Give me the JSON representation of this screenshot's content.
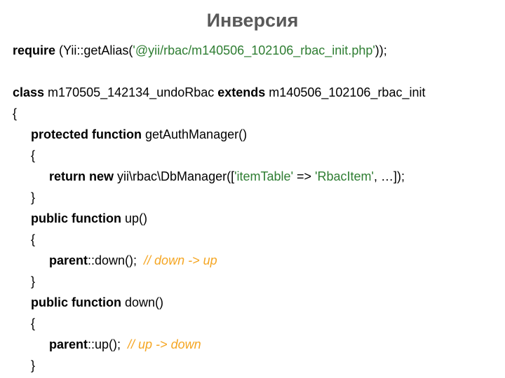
{
  "title": "Инверсия",
  "code": {
    "l1": {
      "a": "require",
      "b": " (Yii::getAlias(",
      "c": "'@yii/rbac/m140506_102106_rbac_init.php'",
      "d": "));"
    },
    "l3": {
      "a": "class",
      "b": " m170505_142134_undoRbac ",
      "c": "extends",
      "d": " m140506_102106_rbac_init"
    },
    "l4": "{",
    "l5": {
      "a": "protected function",
      "b": " getAuthManager()"
    },
    "l6": "{",
    "l7": {
      "a": "return new",
      "b": " yii\\rbac\\DbManager([",
      "c": "'itemTable'",
      "d": " => ",
      "e": "'RbacItem'",
      "f": ", …]);"
    },
    "l8": "}",
    "l9": {
      "a": "public function",
      "b": " up()"
    },
    "l10": "{",
    "l11": {
      "a": "parent",
      "b": "::down();  ",
      "c": "// down -> up"
    },
    "l12": "}",
    "l13": {
      "a": "public function",
      "b": " down()"
    },
    "l14": "{",
    "l15": {
      "a": "parent",
      "b": "::up();  ",
      "c": "// up -> down"
    },
    "l16": "}"
  }
}
